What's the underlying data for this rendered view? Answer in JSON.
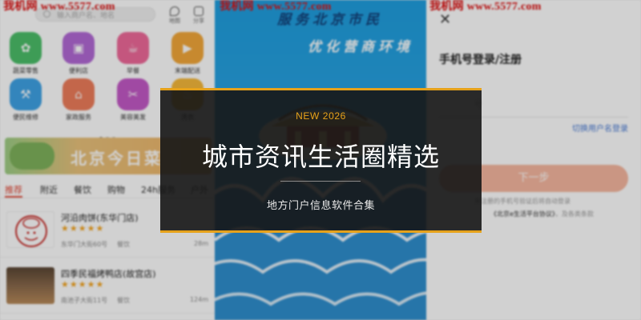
{
  "watermark": "我机网 www.5577.com",
  "overlay": {
    "tag": "NEW 2026",
    "title": "城市资讯生活圈精选",
    "subtitle": "地方门户信息软件合集"
  },
  "colors": {
    "accent": "#e6a21b",
    "overlay_bg": "#161616",
    "brand_red": "#e24b3a",
    "splash_blue": "#2aa3e3",
    "login_button": "#f7b8a0"
  },
  "home": {
    "search_placeholder": "输入商户名、地名",
    "map_label": "地图",
    "share_label": "分享",
    "categories": [
      {
        "label": "蔬菜零售",
        "icon": "vegetable-icon",
        "color": "#4cbf6a"
      },
      {
        "label": "便利店",
        "icon": "store-icon",
        "color": "#b36ad6"
      },
      {
        "label": "早餐",
        "icon": "breakfast-icon",
        "color": "#ef6a9a"
      },
      {
        "label": "末端配送",
        "icon": "delivery-icon",
        "color": "#f3a83a"
      },
      {
        "label": "便民维修",
        "icon": "wrench-icon",
        "color": "#3fa3e6"
      },
      {
        "label": "家政服务",
        "icon": "home-service-icon",
        "color": "#ee7d5b"
      },
      {
        "label": "美容美发",
        "icon": "scissors-icon",
        "color": "#c45ac7"
      },
      {
        "label": "洗衣",
        "icon": "laundry-icon",
        "color": "#f6b93b"
      }
    ],
    "banner_text": "北京今日菜",
    "tabs": [
      "推荐",
      "附近",
      "餐饮",
      "购物",
      "24h服务",
      "户外"
    ],
    "shops": [
      {
        "name": "河沿肉饼(东华门店)",
        "stars": "★★★★★",
        "address": "东华门大街60号",
        "category": "餐饮",
        "distance": "28m"
      },
      {
        "name": "四季民福烤鸭店(故宫店)",
        "stars": "★★★★★",
        "address": "南池子大街11号",
        "category": "餐饮",
        "distance": "124m"
      }
    ]
  },
  "splash": {
    "slogan_top": "服务北京市民",
    "slogan_bottom": "优化营商环境"
  },
  "login": {
    "title": "手机号登录/注册",
    "phone_placeholder": "号",
    "switch_link": "切换用户名登录",
    "next_button": "下一步",
    "terms_line1": "未注册的手机号验证后将自动登录",
    "terms_agreement": "《北京e生活平台协议》",
    "terms_suffix": "，及各类条款"
  }
}
